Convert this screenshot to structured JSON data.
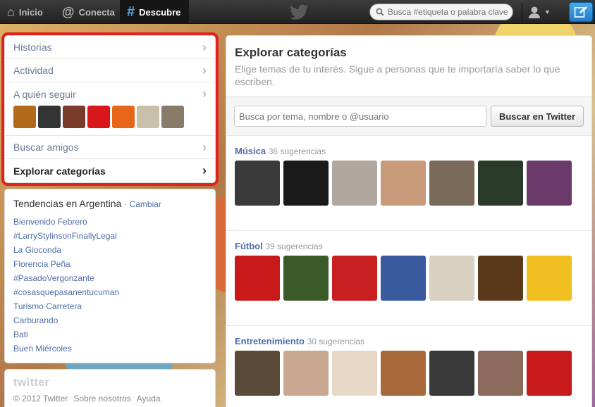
{
  "topbar": {
    "nav": [
      {
        "label": "Inicio",
        "icon": "home-icon"
      },
      {
        "label": "Conecta",
        "icon": "at-icon"
      },
      {
        "label": "Descubre",
        "icon": "hashtag-icon"
      }
    ],
    "search_placeholder": "Busca #etiqueta o palabra clave"
  },
  "dashboard": {
    "items": [
      {
        "label": "Historias"
      },
      {
        "label": "Actividad"
      }
    ],
    "who_to_follow": {
      "label": "A quién seguir",
      "avatar_colors": [
        "#b06a1a",
        "#333333",
        "#7a3b2a",
        "#d8161c",
        "#e8661a",
        "#c8c0a8",
        "#8a7a6a"
      ]
    },
    "find_friends": "Buscar amigos",
    "browse_categories": "Explorar categorías"
  },
  "trends": {
    "title": "Tendencias en Argentina",
    "change": "· Cambiar",
    "items": [
      "Bienvenido Febrero",
      "#LarryStylinsonFinallyLegal",
      "La Gioconda",
      "Florencia Peña",
      "#PasadoVergonzante",
      "#cosasquepasanentucuman",
      "Turismo Carretera",
      "Carburando",
      "Bati",
      "Buen Miércoles"
    ]
  },
  "footer": {
    "logo": "twitter",
    "links": [
      "© 2012 Twitter",
      "Sobre nosotros",
      "Ayuda"
    ]
  },
  "main": {
    "title": "Explorar categorías",
    "subtitle": "Elige temas de tu interés. Sigue a personas que te importaría saber lo que escriben.",
    "search_placeholder": "Busca por tema, nombre o @usuario",
    "search_button": "Buscar en Twitter",
    "categories": [
      {
        "name": "Música",
        "count": "36 sugerencias",
        "thumb_colors": [
          "#3a3a3a",
          "#1a1a1a",
          "#b0a8a0",
          "#c89a7a",
          "#7a6a5a",
          "#2a3a2a",
          "#6a3a6a"
        ]
      },
      {
        "name": "Fútbol",
        "count": "39 sugerencias",
        "thumb_colors": [
          "#c81a1a",
          "#3a5a2a",
          "#c82020",
          "#3a5aa0",
          "#d8d0c0",
          "#5a3a1a",
          "#f0c020"
        ]
      },
      {
        "name": "Entretenimiento",
        "count": "30 sugerencias",
        "thumb_colors": [
          "#5a4a3a",
          "#c8a890",
          "#e8d8c8",
          "#a86a3a",
          "#3a3a3a",
          "#8a6a5a",
          "#c81a1a"
        ]
      }
    ]
  }
}
